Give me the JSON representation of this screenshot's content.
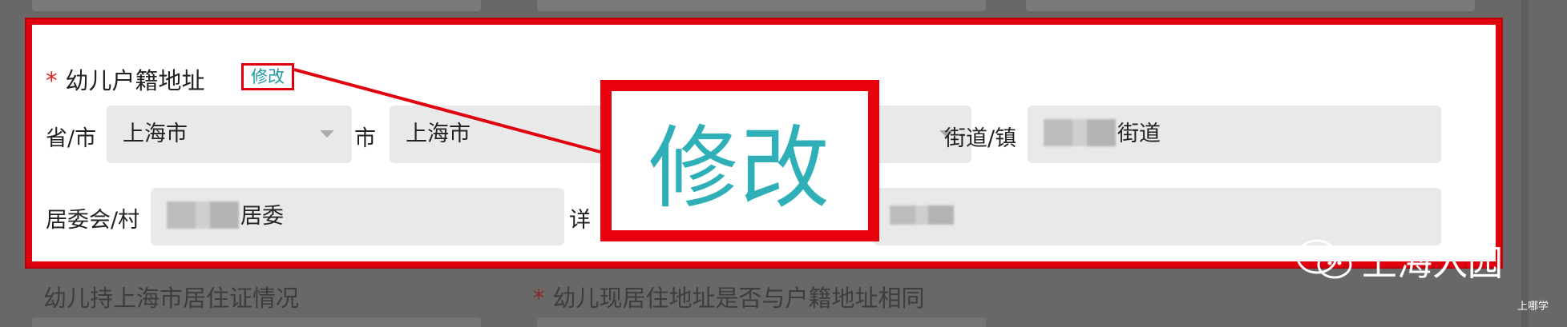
{
  "address_section": {
    "required_mark": "*",
    "title": "幼儿户籍地址",
    "edit_link": "修改",
    "province_label": "省/市",
    "province_value": "上海市",
    "city_label": "市",
    "city_value": "上海市",
    "street_label": "街道/镇",
    "street_value_suffix": "街道",
    "committee_label": "居委会/村",
    "committee_value_suffix": "居委",
    "detail_label_visible": "详"
  },
  "zoom_callout": {
    "text": "修改"
  },
  "background": {
    "residence_permit_label": "幼儿持上海市居住证情况",
    "same_address_required_mark": "*",
    "same_address_label": "幼儿现居住地址是否与户籍地址相同"
  },
  "watermark": {
    "text": "上海入园",
    "corner_text": "上哪学"
  },
  "colors": {
    "highlight_red": "#e0000d",
    "link_teal": "#1e9aa6",
    "required_red": "#e02020"
  }
}
